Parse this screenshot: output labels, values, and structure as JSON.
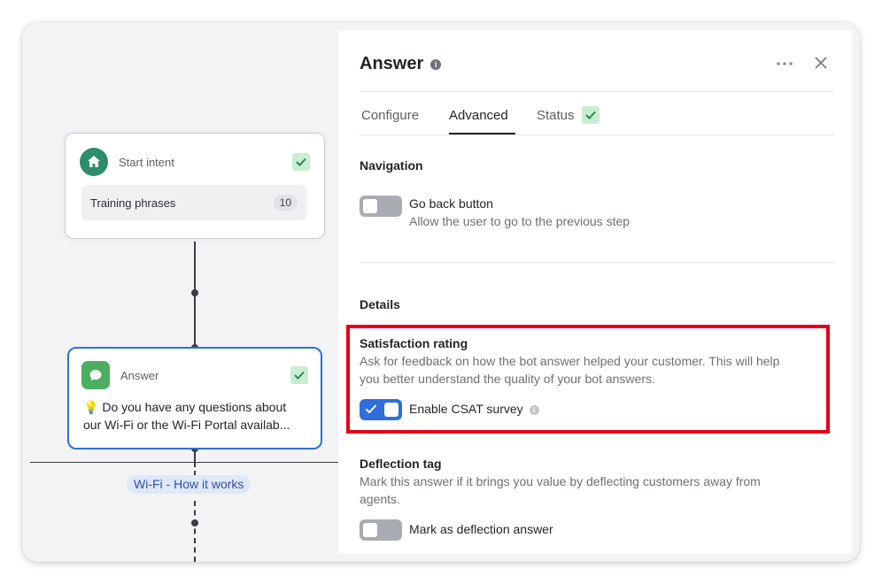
{
  "canvas": {
    "start_node": {
      "title": "Start intent",
      "phrases_label": "Training phrases",
      "phrases_count": "10"
    },
    "answer_node": {
      "title": "Answer",
      "text_line1": "Do you have any questions about",
      "text_line2": "our Wi-Fi or the Wi-Fi Portal availab..."
    },
    "branch_tag": "Wi-Fi - How it works"
  },
  "panel": {
    "title": "Answer",
    "tabs": [
      {
        "label": "Configure",
        "active": false
      },
      {
        "label": "Advanced",
        "active": true
      },
      {
        "label": "Status",
        "active": false
      }
    ],
    "navigation": {
      "title": "Navigation",
      "go_back": {
        "label": "Go back button",
        "desc": "Allow the user to go to the previous step",
        "enabled": false
      }
    },
    "details": {
      "title": "Details",
      "satisfaction": {
        "title": "Satisfaction rating",
        "desc_line1": "Ask for feedback on how the bot answer helped your customer. This will help",
        "desc_line2": "you better understand the quality of your bot answers.",
        "csat_label": "Enable CSAT survey",
        "enabled": true
      },
      "deflection": {
        "title": "Deflection tag",
        "desc_line1": "Mark this answer if it brings you value by deflecting customers away from",
        "desc_line2": "agents.",
        "toggle_label": "Mark as deflection answer",
        "enabled": false
      }
    }
  },
  "colors": {
    "accent": "#2f6fdc",
    "highlight": "#e3001b",
    "success": "#c9ecd2",
    "home_avatar": "#2e8b6e",
    "chat_avatar": "#4caf5f"
  },
  "icons": [
    "home-icon",
    "chat-icon",
    "check-icon",
    "info-icon",
    "more-icon",
    "close-icon",
    "bulb-icon"
  ]
}
